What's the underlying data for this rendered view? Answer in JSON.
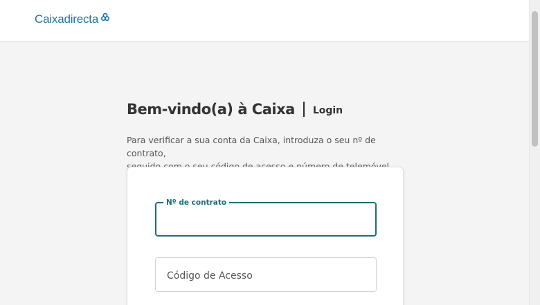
{
  "header": {
    "logo_text": "Caixadirecta",
    "logo_icon": "caixa-knot-icon",
    "brand_color": "#1e73a8"
  },
  "main": {
    "title": "Bem-vindo(a) à Caixa",
    "subtitle": "Login",
    "intro_line1": "Para verificar a sua conta da Caixa, introduza o seu nº de contrato,",
    "intro_line2": "seguido com o seu código de acesso e número de telemóvel."
  },
  "form": {
    "contract_label": "Nº de contrato",
    "contract_value": "",
    "access_code_placeholder": "Código de Acesso",
    "access_code_value": "",
    "accent_color": "#1b6f73"
  }
}
